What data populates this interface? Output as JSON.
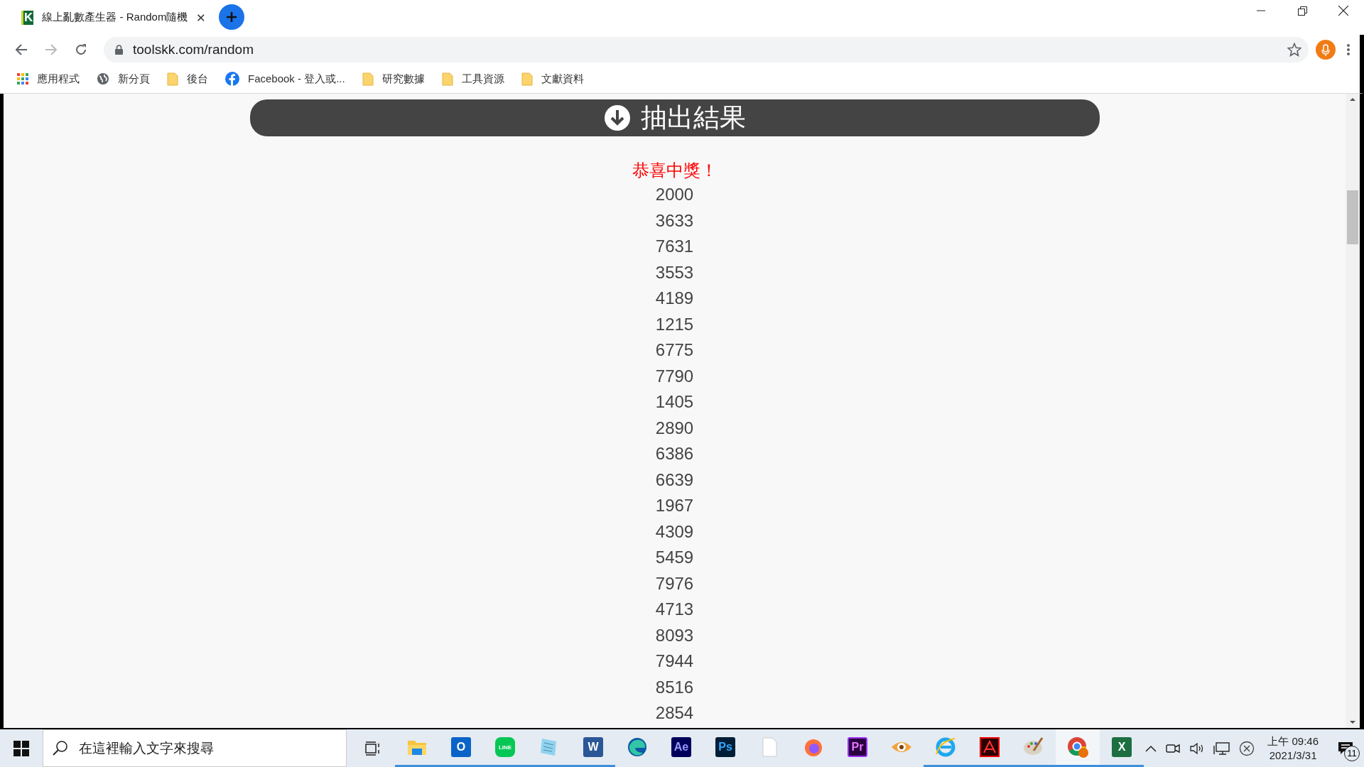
{
  "browser": {
    "tab": {
      "favicon": "K",
      "title": "線上亂數產生器 - Random隨機",
      "selected": true
    },
    "back_disabled": false,
    "forward_disabled": true,
    "address": "toolskk.com/random",
    "bookmarks": [
      {
        "kind": "apps",
        "label": "應用程式"
      },
      {
        "kind": "globe",
        "label": "新分頁"
      },
      {
        "kind": "folder",
        "label": "後台"
      },
      {
        "kind": "facebook",
        "label": "Facebook - 登入或..."
      },
      {
        "kind": "folder",
        "label": "研究數據"
      },
      {
        "kind": "folder",
        "label": "工具資源"
      },
      {
        "kind": "folder",
        "label": "文獻資料"
      }
    ]
  },
  "page": {
    "draw_button": "抽出結果",
    "message": "恭喜中獎！",
    "numbers": [
      "2000",
      "3633",
      "7631",
      "3553",
      "4189",
      "1215",
      "6775",
      "7790",
      "1405",
      "2890",
      "6386",
      "6639",
      "1967",
      "4309",
      "5459",
      "7976",
      "4713",
      "8093",
      "7944",
      "8516",
      "2854"
    ]
  },
  "taskbar": {
    "search_placeholder": "在這裡輸入文字來搜尋",
    "apps": [
      {
        "kind": "explorer",
        "running": true,
        "active": false
      },
      {
        "kind": "outlook",
        "glyph": "O",
        "running": true,
        "active": false
      },
      {
        "kind": "line",
        "glyph": "LINE",
        "running": true,
        "active": false
      },
      {
        "kind": "notepad",
        "running": true,
        "active": false
      },
      {
        "kind": "word",
        "glyph": "W",
        "running": true,
        "active": false
      },
      {
        "kind": "edge",
        "running": false,
        "active": false
      },
      {
        "kind": "ae",
        "glyph": "Ae",
        "running": false,
        "active": false
      },
      {
        "kind": "ps",
        "glyph": "Ps",
        "running": false,
        "active": false
      },
      {
        "kind": "file",
        "running": false,
        "active": false
      },
      {
        "kind": "firefox",
        "running": false,
        "active": false
      },
      {
        "kind": "pr",
        "glyph": "Pr",
        "running": false,
        "active": false
      },
      {
        "kind": "eye",
        "running": false,
        "active": false
      },
      {
        "kind": "ie",
        "running": true,
        "active": false
      },
      {
        "kind": "acrobat",
        "running": true,
        "active": false
      },
      {
        "kind": "paint",
        "running": true,
        "active": false
      },
      {
        "kind": "chrome",
        "running": true,
        "active": true
      },
      {
        "kind": "excel",
        "glyph": "X",
        "running": true,
        "active": false
      }
    ],
    "clock": {
      "time": "上午 09:46",
      "date": "2021/3/31"
    },
    "notifications": "11"
  }
}
